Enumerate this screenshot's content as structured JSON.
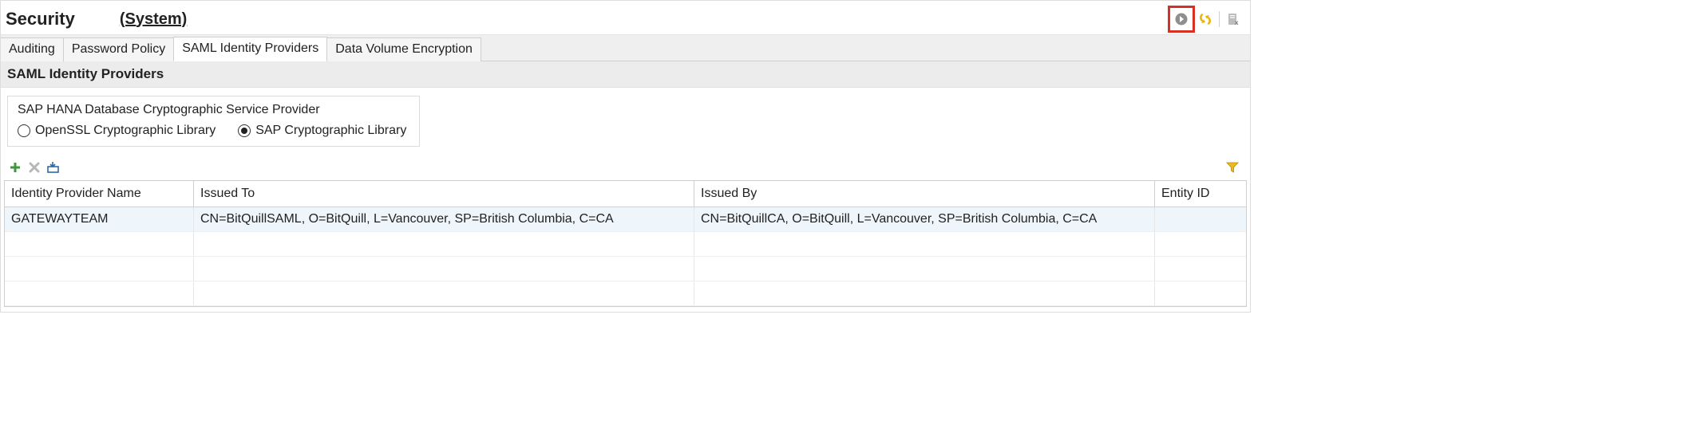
{
  "header": {
    "title": "Security",
    "context": "(System)"
  },
  "tabs": [
    {
      "label": "Auditing",
      "active": false
    },
    {
      "label": "Password Policy",
      "active": false
    },
    {
      "label": "SAML Identity Providers",
      "active": true
    },
    {
      "label": "Data Volume Encryption",
      "active": false
    }
  ],
  "section_title": "SAML Identity Providers",
  "provider_group": {
    "legend": "SAP HANA Database Cryptographic Service Provider",
    "options": [
      {
        "label": "OpenSSL Cryptographic Library",
        "selected": false
      },
      {
        "label": "SAP Cryptographic Library",
        "selected": true
      }
    ]
  },
  "table": {
    "columns": [
      "Identity Provider Name",
      "Issued To",
      "Issued By",
      "Entity ID"
    ],
    "rows": [
      {
        "name": "GATEWAYTEAM",
        "issued_to": "CN=BitQuillSAML, O=BitQuill, L=Vancouver, SP=British Columbia, C=CA",
        "issued_by": "CN=BitQuillCA, O=BitQuill, L=Vancouver, SP=British Columbia, C=CA",
        "entity_id": ""
      }
    ]
  }
}
